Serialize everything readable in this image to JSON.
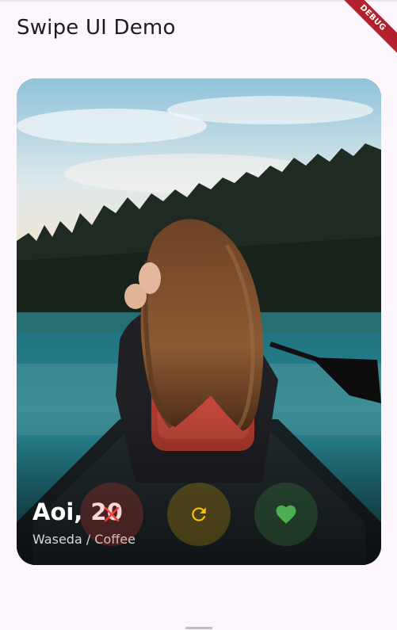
{
  "app": {
    "title": "Swipe UI Demo",
    "debug_banner": "DEBUG"
  },
  "card": {
    "name_age": "Aoi, 20",
    "subtitle": "Waseda / Coffee",
    "photo_icon": "photo-woman-canoe-lake"
  },
  "actions": {
    "nope_icon": "close-icon",
    "undo_icon": "refresh-icon",
    "like_icon": "heart-icon",
    "colors": {
      "nope": "#f44336",
      "undo": "#ffc107",
      "like": "#4caf50"
    }
  }
}
